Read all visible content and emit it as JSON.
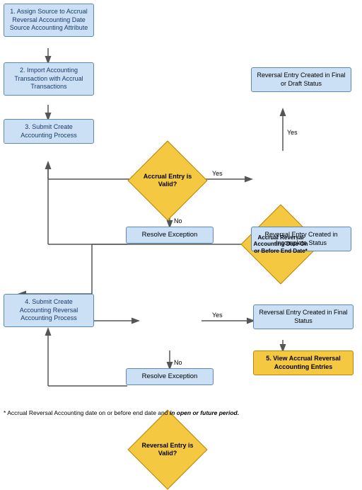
{
  "nodes": {
    "step1": {
      "label": "1. Assign Source to Accrual Reversal Accounting Date Source Accounting Attribute",
      "type": "rect"
    },
    "step2": {
      "label": "2. Import Accounting Transaction with Accrual Transactions",
      "type": "rect"
    },
    "step3": {
      "label": "3. Submit Create Accounting Process",
      "type": "rect"
    },
    "diamond1": {
      "label": "Accrual Entry is Valid?",
      "type": "diamond"
    },
    "resolve1": {
      "label": "Resolve Exception",
      "type": "rect"
    },
    "diamond2": {
      "label": "Accrual Reversal Accounting Date On or Before End Date*",
      "type": "diamond"
    },
    "reversal_final_draft": {
      "label": "Reversal Entry Created in Final or Draft Status",
      "type": "rect"
    },
    "reversal_incomplete": {
      "label": "Reversal Entry Created in Incomplete Status",
      "type": "rect"
    },
    "step4": {
      "label": "4. Submit Create Accounting Reversal Accounting Process",
      "type": "rect"
    },
    "diamond3": {
      "label": "Reversal Entry is Valid?",
      "type": "diamond"
    },
    "resolve2": {
      "label": "Resolve Exception",
      "type": "rect"
    },
    "reversal_final": {
      "label": "Reversal Entry Created in Final Status",
      "type": "rect"
    },
    "step5": {
      "label": "5. View Accrual Reversal Accounting Entries",
      "type": "rect-orange"
    },
    "note": {
      "label": "* Accrual Reversal Accounting date on or before end date and in open or future period.",
      "italic_parts": [
        "in open or future period"
      ]
    }
  },
  "arrows": {
    "labels": {
      "yes": "Yes",
      "no": "No"
    }
  }
}
